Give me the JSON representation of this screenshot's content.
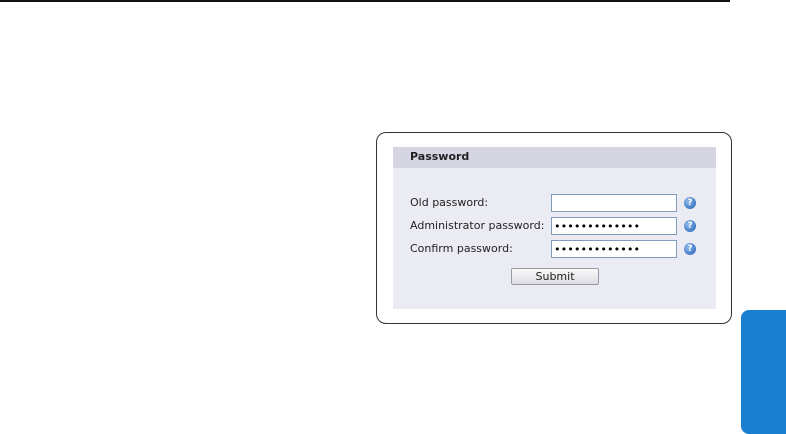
{
  "colors": {
    "side_tab": "#1a7fd0",
    "panel_background": "#ebebf4",
    "panel_header": "#d6d6e2",
    "help_icon": "#1f5fb6",
    "input_border": "#7f9db9"
  },
  "panel": {
    "title": "Password",
    "fields": [
      {
        "label": "Old password:",
        "value": "",
        "type": "password",
        "help_icon": "question-icon"
      },
      {
        "label": "Administrator password:",
        "value": "•••••••••••••",
        "type": "password",
        "help_icon": "question-icon"
      },
      {
        "label": "Confirm password:",
        "value": "•••••••••••••",
        "type": "password",
        "help_icon": "question-icon"
      }
    ],
    "help_glyph": "?",
    "submit_label": "Submit"
  }
}
